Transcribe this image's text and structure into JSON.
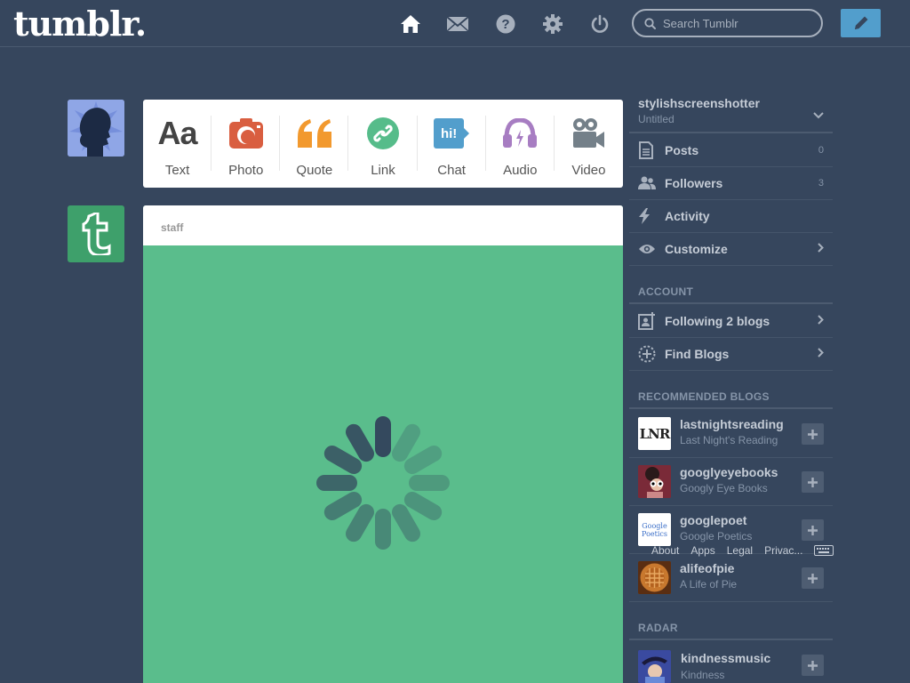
{
  "header": {
    "logo": "tumblr.",
    "search_placeholder": "Search Tumblr",
    "accent": "#529ecc"
  },
  "post_types": [
    {
      "label": "Text",
      "icon": "text-icon",
      "glyph": "Aa",
      "color": "#444444"
    },
    {
      "label": "Photo",
      "icon": "camera-icon",
      "color": "#d95e40"
    },
    {
      "label": "Quote",
      "icon": "quote-icon",
      "color": "#f2992e"
    },
    {
      "label": "Link",
      "icon": "link-icon",
      "color": "#56bc8a"
    },
    {
      "label": "Chat",
      "icon": "chat-icon",
      "glyph": "hi!",
      "color": "#529ecc"
    },
    {
      "label": "Audio",
      "icon": "headphones-icon",
      "color": "#a77dc2"
    },
    {
      "label": "Video",
      "icon": "video-camera-icon",
      "color": "#748089"
    }
  ],
  "post": {
    "author": "staff",
    "background": "#5abd8c"
  },
  "sidebar": {
    "blog_name": "stylishscreenshotter",
    "blog_title": "Untitled",
    "menu": [
      {
        "label": "Posts",
        "count": "0"
      },
      {
        "label": "Followers",
        "count": "3"
      },
      {
        "label": "Activity"
      },
      {
        "label": "Customize"
      }
    ],
    "account_title": "ACCOUNT",
    "account": [
      {
        "label": "Following 2 blogs"
      },
      {
        "label": "Find Blogs"
      }
    ],
    "recommended_title": "RECOMMENDED BLOGS",
    "recommended": [
      {
        "name": "lastnightsreading",
        "title": "Last Night's Reading",
        "thumb_text": "LNR"
      },
      {
        "name": "googlyeyebooks",
        "title": "Googly Eye Books"
      },
      {
        "name": "googlepoet",
        "title": "Google Poetics",
        "thumb_text": "Google Poetics"
      },
      {
        "name": "alifeofpie",
        "title": "A Life of Pie"
      }
    ],
    "radar_title": "RADAR",
    "radar": [
      {
        "name": "kindnessmusic",
        "title": "Kindness"
      }
    ],
    "footer": [
      "About",
      "Apps",
      "Legal",
      "Privac..."
    ]
  }
}
